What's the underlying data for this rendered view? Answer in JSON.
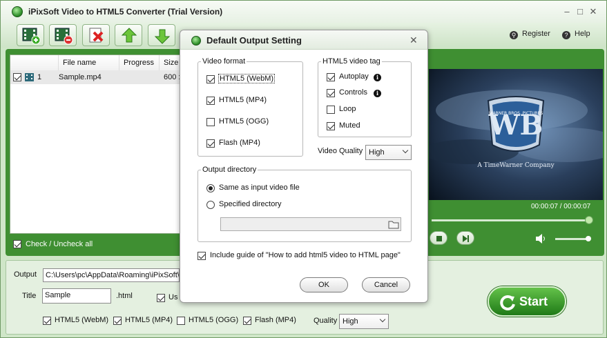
{
  "window": {
    "title": "iPixSoft Video to HTML5 Converter (Trial Version)"
  },
  "toolbar": {
    "buttons": [
      "add-video-icon",
      "remove-video-icon",
      "clear-list-icon",
      "move-up-icon",
      "move-down-icon"
    ],
    "register_label": "Register",
    "help_label": "Help"
  },
  "file_list": {
    "columns": [
      "File name",
      "Progress",
      "Size"
    ],
    "rows": [
      {
        "index": "1",
        "name": "Sample.mp4",
        "size": "600 :"
      }
    ],
    "check_all_label": "Check / Uncheck all"
  },
  "preview": {
    "time": "00:00:07 / 00:00:07",
    "logo_text": "A TimeWarner Company",
    "logo_letters": "WB",
    "logo_arc": "WARNER BROS. PICTURES"
  },
  "output": {
    "output_label": "Output",
    "output_path": "C:\\Users\\pc\\AppData\\Roaming\\iPixSoft\\V",
    "title_label": "Title",
    "title_value": "Sample",
    "ext": ".html",
    "use_label": "Us",
    "formats": [
      "HTML5 (WebM)",
      "HTML5 (MP4)",
      "HTML5 (OGG)",
      "Flash (MP4)"
    ],
    "quality_label": "Quality",
    "quality_value": "High",
    "start_label": "Start"
  },
  "dialog": {
    "title": "Default Output Setting",
    "video_format": {
      "legend": "Video format",
      "options": [
        {
          "label": "HTML5 (WebM)",
          "checked": true
        },
        {
          "label": "HTML5 (MP4)",
          "checked": true
        },
        {
          "label": "HTML5 (OGG)",
          "checked": false
        },
        {
          "label": "Flash (MP4)",
          "checked": true
        }
      ]
    },
    "html5_tag": {
      "legend": "HTML5 video tag",
      "options": [
        {
          "label": "Autoplay",
          "checked": true
        },
        {
          "label": "Controls",
          "checked": true
        },
        {
          "label": "Loop",
          "checked": false
        },
        {
          "label": "Muted",
          "checked": true
        }
      ]
    },
    "quality_label": "Video Quality",
    "quality_value": "High",
    "output_directory": {
      "legend": "Output directory",
      "same_label": "Same as input video file",
      "specified_label": "Specified directory",
      "path_value": ""
    },
    "include_guide_label": "Include guide of \"How to add html5 video to HTML page\"",
    "ok_label": "OK",
    "cancel_label": "Cancel"
  }
}
